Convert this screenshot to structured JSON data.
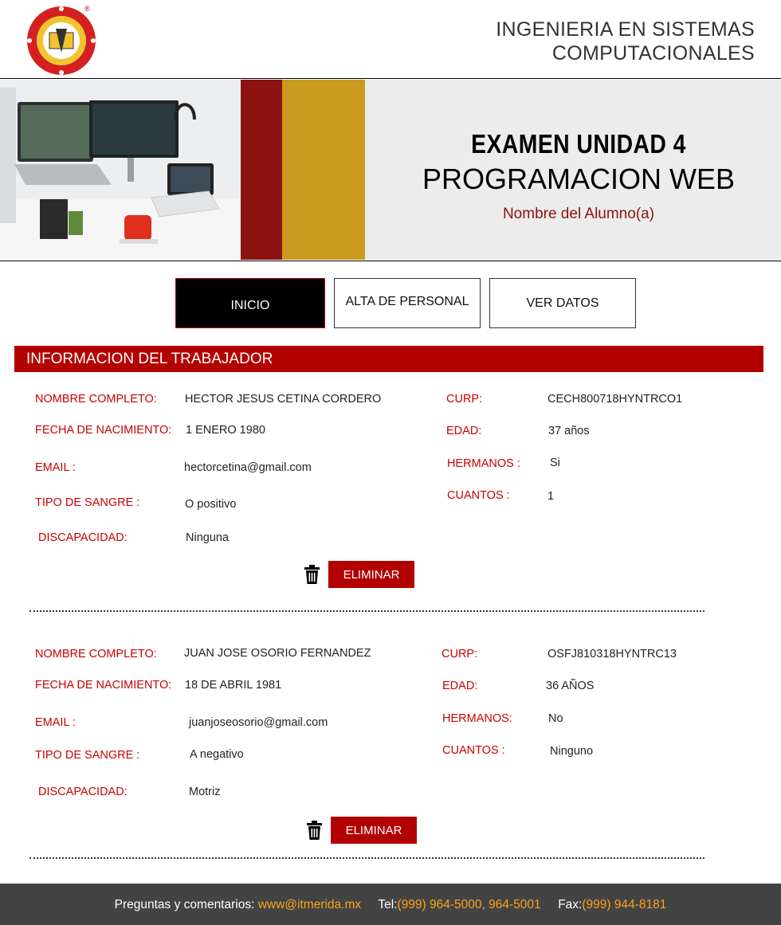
{
  "header": {
    "school_line1": "INGENIERIA EN SISTEMAS",
    "school_line2": "COMPUTACIONALES"
  },
  "banner": {
    "title": "EXAMEN UNIDAD 4",
    "subtitle": "PROGRAMACION WEB",
    "student": "Nombre del Alumno(a)"
  },
  "nav": {
    "inicio": "INICIO",
    "alta": "ALTA DE PERSONAL",
    "ver": "VER DATOS"
  },
  "section": {
    "title": "INFORMACION DEL TRABAJADOR"
  },
  "labels": {
    "nombre": "NOMBRE COMPLETO:",
    "fecha": "FECHA DE NACIMIENTO:",
    "email": "EMAIL :",
    "sangre": "TIPO DE SANGRE :",
    "discapacidad": "DISCAPACIDAD:",
    "curp": "CURP:",
    "edad": "EDAD:",
    "hermanos_1": "HERMANOS :",
    "hermanos_2": "HERMANOS:",
    "cuantos": "CUANTOS :"
  },
  "records": [
    {
      "nombre": "HECTOR JESUS CETINA CORDERO",
      "fecha": "1 ENERO 1980",
      "email": "hectorcetina@gmail.com",
      "sangre": "O positivo",
      "discapacidad": "Ninguna",
      "curp": "CECH800718HYNTRCO1",
      "edad": "37 años",
      "hermanos": "Si",
      "cuantos": "1",
      "delete_label": "ELIMINAR"
    },
    {
      "nombre": "JUAN JOSE OSORIO FERNANDEZ",
      "fecha": "18 DE ABRIL 1981",
      "email": "juanjoseosorio@gmail.com",
      "sangre": "A negativo",
      "discapacidad": "Motriz",
      "curp": "OSFJ810318HYNTRC13",
      "edad": "36 AÑOS",
      "hermanos": "No",
      "cuantos": "Ninguno",
      "delete_label": "ELIMINAR"
    }
  ],
  "footer": {
    "questions_label": "Preguntas y comentarios:",
    "website": "www@itmerida.mx",
    "tel_label": "Tel:",
    "tel": "(999) 964-5000, 964-5001",
    "fax_label": "Fax:",
    "fax": "(999) 944-8181"
  },
  "colors": {
    "accent_red": "#b30000",
    "dark_red": "#8d1212",
    "gold": "#c99a1d",
    "footer_bg": "#434343",
    "footer_highlight": "#f7a51d"
  },
  "icons": {
    "logo": "institute-seal-logo",
    "delete": "trash-icon"
  }
}
